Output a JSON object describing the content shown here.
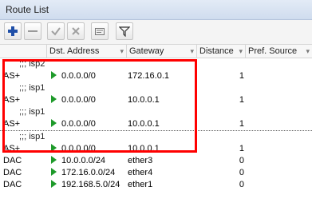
{
  "window": {
    "title": "Route List"
  },
  "toolbar": {
    "buttons": [
      {
        "name": "add-button",
        "icon": "plus-icon"
      },
      {
        "name": "remove-button",
        "icon": "minus-icon"
      },
      {
        "name": "enable-button",
        "icon": "check-icon"
      },
      {
        "name": "disable-button",
        "icon": "x-icon"
      },
      {
        "name": "comment-button",
        "icon": "comment-icon"
      },
      {
        "name": "filter-button",
        "icon": "filter-icon"
      }
    ]
  },
  "columns": [
    "",
    "Dst. Address",
    "Gateway",
    "Distance",
    "Pref. Source"
  ],
  "rows": [
    {
      "comment": ";;; isp2"
    },
    {
      "flag": "AS+",
      "dst": "0.0.0.0/0",
      "gateway": "172.16.0.1",
      "distance": "1"
    },
    {
      "comment": ";;; isp1"
    },
    {
      "flag": "AS+",
      "dst": "0.0.0.0/0",
      "gateway": "10.0.0.1",
      "distance": "1"
    },
    {
      "comment": ";;; isp1"
    },
    {
      "flag": "AS+",
      "dst": "0.0.0.0/0",
      "gateway": "10.0.0.1",
      "distance": "1"
    },
    {
      "comment": ";;; isp1"
    },
    {
      "flag": "AS+",
      "dst": "0.0.0.0/0",
      "gateway": "10.0.0.1",
      "distance": "1"
    },
    {
      "flag": "DAC",
      "dst": "10.0.0.0/24",
      "gateway": "ether3",
      "distance": "0"
    },
    {
      "flag": "DAC",
      "dst": "172.16.0.0/24",
      "gateway": "ether4",
      "distance": "0"
    },
    {
      "flag": "DAC",
      "dst": "192.168.5.0/24",
      "gateway": "ether1",
      "distance": "0"
    }
  ],
  "colors": {
    "highlight": "#ff0000",
    "active_route_triangle": "#1e9a2a",
    "add_icon": "#1f4fa8"
  }
}
